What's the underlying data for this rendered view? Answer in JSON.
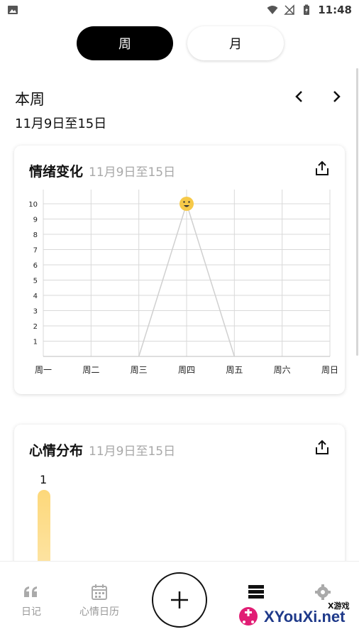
{
  "status_bar": {
    "time": "11:48"
  },
  "segments": {
    "week": "周",
    "month": "月",
    "active": "week"
  },
  "period": {
    "title": "本周",
    "range": "11月9日至15日"
  },
  "mood_trend_card": {
    "title": "情绪变化",
    "subtitle": "11月9日至15日",
    "chart_data": {
      "type": "line",
      "categories": [
        "周一",
        "周二",
        "周三",
        "周四",
        "周五",
        "周六",
        "周日"
      ],
      "values": [
        null,
        null,
        0,
        10,
        0,
        null,
        null
      ],
      "y_ticks": [
        1,
        2,
        3,
        4,
        5,
        6,
        7,
        8,
        9,
        10
      ],
      "ylim": [
        0,
        10
      ],
      "grid": true,
      "marker": "smiley-face",
      "colors": {
        "line": "#d0d0d0",
        "marker": "#f6c948",
        "grid": "#d9d9d9"
      }
    }
  },
  "mood_distribution_card": {
    "title": "心情分布",
    "subtitle": "11月9日至15日",
    "bar_value": "1",
    "bar_color": "#fdd87a"
  },
  "bottom_nav": {
    "diary": "日记",
    "calendar": "心情日历",
    "stats": "",
    "settings": ""
  },
  "watermark": {
    "brand": "XYouXi.net",
    "tag": "X游戏"
  }
}
